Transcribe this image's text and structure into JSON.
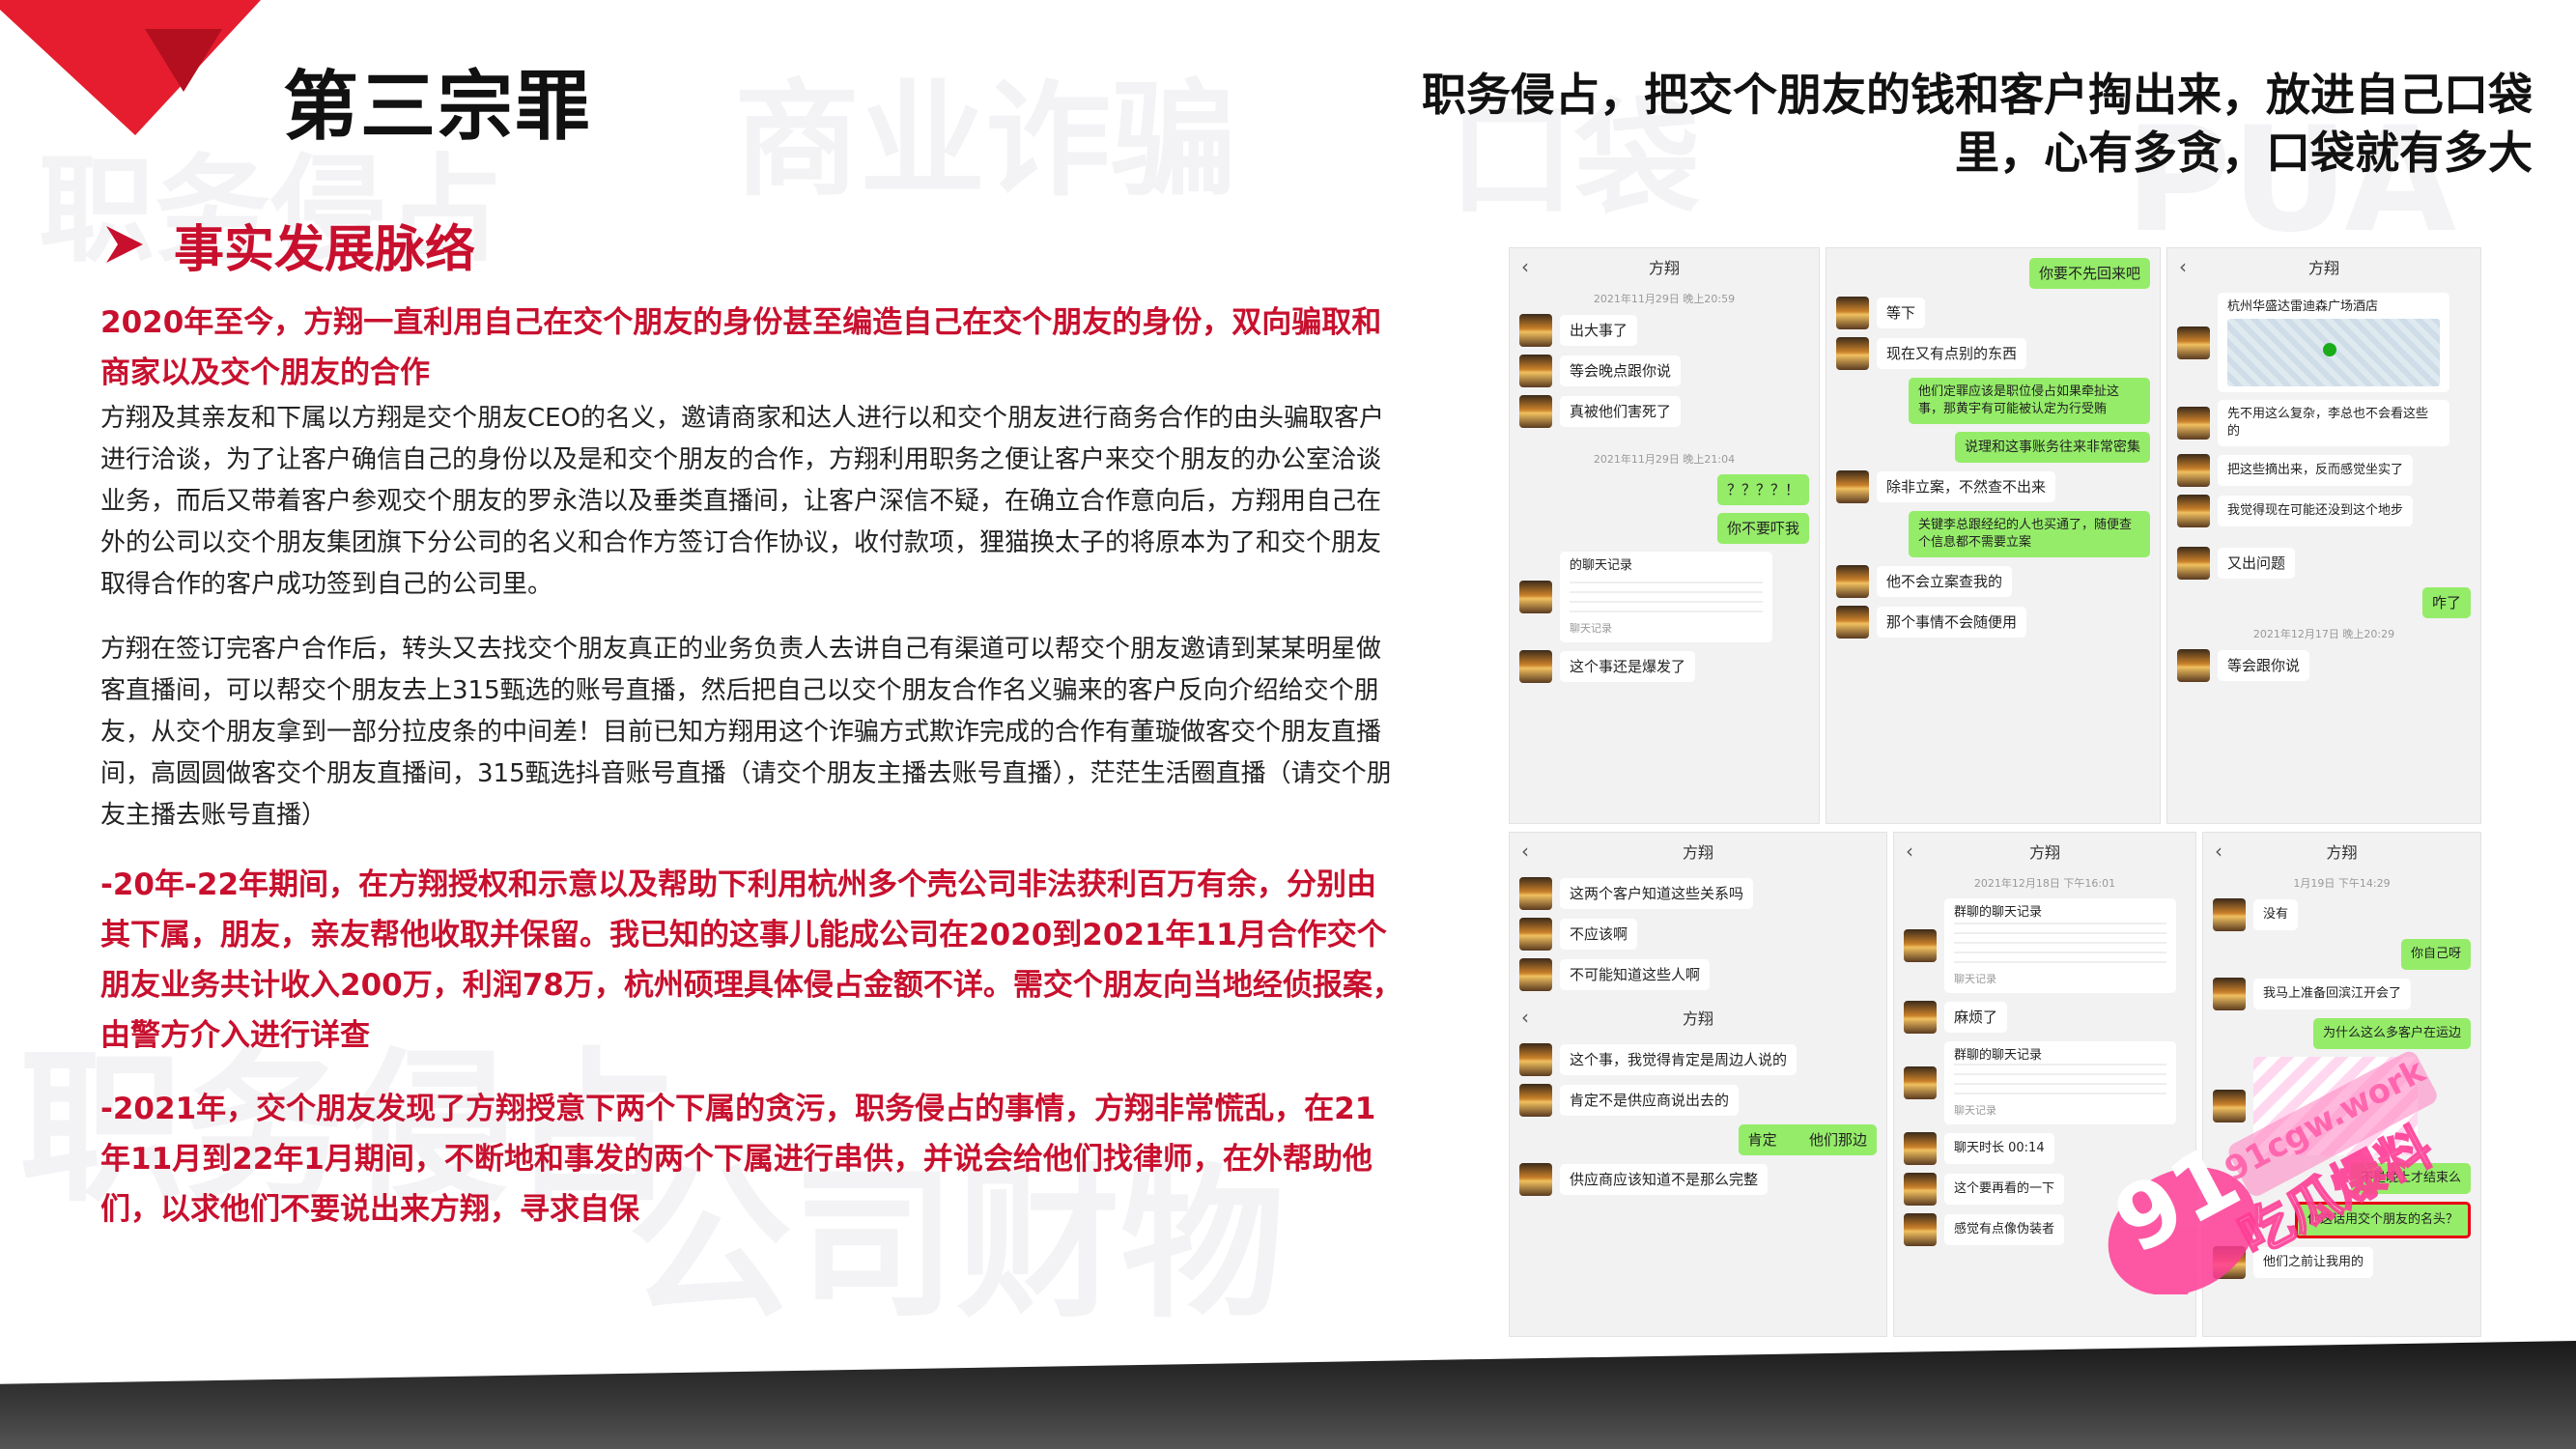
{
  "header": {
    "title": "第三宗罪",
    "subtitle_line1": "职务侵占，把交个朋友的钱和客户掏出来，放进自己口袋",
    "subtitle_line2": "里，心有多贪，口袋就有多大"
  },
  "section": {
    "title": "事实发展脉络"
  },
  "content": {
    "red1": "2020年至今，方翔一直利用自己在交个朋友的身份甚至编造自己在交个朋友的身份，双向骗取和商家以及交个朋友的合作",
    "para1": "方翔及其亲友和下属以方翔是交个朋友CEO的名义，邀请商家和达人进行以和交个朋友进行商务合作的由头骗取客户进行洽谈，为了让客户确信自己的身份以及是和交个朋友的合作，方翔利用职务之便让客户来交个朋友的办公室洽谈业务，而后又带着客户参观交个朋友的罗永浩以及垂类直播间，让客户深信不疑，在确立合作意向后，方翔用自己在外的公司以交个朋友集团旗下分公司的名义和合作方签订合作协议，收付款项，狸猫换太子的将原本为了和交个朋友取得合作的客户成功签到自己的公司里。",
    "para2": "方翔在签订完客户合作后，转头又去找交个朋友真正的业务负责人去讲自己有渠道可以帮交个朋友邀请到某某明星做客直播间，可以帮交个朋友去上315甄选的账号直播，然后把自己以交个朋友合作名义骗来的客户反向介绍给交个朋友，从交个朋友拿到一部分拉皮条的中间差！目前已知方翔用这个诈骗方式欺诈完成的合作有董璇做客交个朋友直播间，高圆圆做客交个朋友直播间，315甄选抖音账号直播（请交个朋友主播去账号直播），茫茫生活圈直播（请交个朋友主播去账号直播）",
    "red2": "-20年-22年期间，在方翔授权和示意以及帮助下利用杭州多个壳公司非法获利百万有余，分别由其下属，朋友，亲友帮他收取并保留。我已知的这事儿能成公司在2020到2021年11月合作交个朋友业务共计收入200万，利润78万，杭州硕理具体侵占金额不详。需交个朋友向当地经侦报案，由警方介入进行详查",
    "red3": "-2021年，交个朋友发现了方翔授意下两个下属的贪污，职务侵占的事情，方翔非常慌乱，在21年11月到22年1月期间，不断地和事发的两个下属进行串供，并说会给他们找律师，在外帮助他们，以求他们不要说出来方翔，寻求自保"
  },
  "chat": {
    "p1": {
      "name": "方翔",
      "ts1": "2021年11月29日 晚上20:59",
      "m1": "出大事了",
      "m2": "等会晚点跟你说",
      "m3": "真被他们害死了",
      "ts2": "2021年11月29日 晚上21:04",
      "m4": "？？？？！",
      "m5": "你不要吓我",
      "card_title": "的聊天记录",
      "card_sub": "聊天记录",
      "m6": "这个事还是爆发了"
    },
    "p2": {
      "m1": "你要不先回来吧",
      "m2": "等下",
      "m3": "现在又有点别的东西",
      "m4": "他们定罪应该是职位侵占如果牵扯这事，那黄宇有可能被认定为行受贿",
      "m5": "说理和这事账务往来非常密集",
      "m6": "除非立案，不然查不出来",
      "m7": "关键李总跟经纪的人也买通了，随便查个信息都不需要立案",
      "m8": "他不会立案查我的",
      "m9": "那个事情不会随便用"
    },
    "p3": {
      "name": "方翔",
      "loc": "杭州华盛达雷迪森广场酒店",
      "m1": "先不用这么复杂，李总也不会看这些的",
      "m2": "把这些摘出来，反而感觉坐实了",
      "m3": "我觉得现在可能还没到这个地步",
      "m4": "又出问题",
      "m5": "咋了",
      "ts": "2021年12月17日 晚上20:29",
      "m6": "等会跟你说"
    },
    "p4": {
      "name": "方翔",
      "m1": "这两个客户知道这些关系吗",
      "m2": "不应该啊",
      "m3": "不可能知道这些人啊",
      "name2": "方翔",
      "m4": "这个事，我觉得肯定是周边人说的",
      "m5": "肯定不是供应商说出去的",
      "m6": "肯定       他们那边",
      "m7": "供应商应该知道不是那么完整"
    },
    "p5": {
      "name": "方翔",
      "ts": "2021年12月18日 下午16:01",
      "card1": "群聊的聊天记录",
      "card1_sub": "聊天记录",
      "m1": "麻烦了",
      "card2": "群聊的聊天记录",
      "card2_sub": "聊天记录",
      "m2": "聊天时长 00:14",
      "m3": "这个要再看的一下",
      "m4": "感觉有点像伪装者"
    },
    "p6": {
      "name": "方翔",
      "ts": "1月19日 下午14:29",
      "m1": "没有",
      "m2": "你自己呀",
      "m3": "我马上准备回滨江开会了",
      "m4": "为什么这么多客户在运边",
      "m5": "不是晚上才结束么",
      "m6": "你这话用交个朋友的名头？",
      "m7": "他们之前让我用的"
    }
  },
  "watermark": {
    "number": "91",
    "brand": "91cgw.work",
    "tag": "吃瓜爆料"
  }
}
